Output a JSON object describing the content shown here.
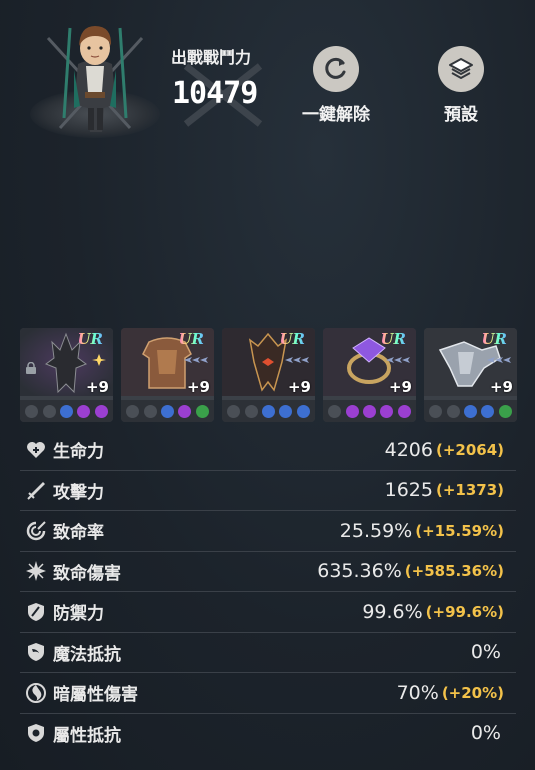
{
  "header": {
    "power_label": "出戰戰鬥力",
    "power_value": "10479",
    "reset_label": "一鍵解除",
    "preset_label": "預設"
  },
  "gear": [
    {
      "rarity": "UR",
      "enhance": "+9",
      "locked": true
    },
    {
      "rarity": "UR",
      "enhance": "+9",
      "locked": false
    },
    {
      "rarity": "UR",
      "enhance": "+9",
      "locked": false
    },
    {
      "rarity": "UR",
      "enhance": "+9",
      "locked": false
    },
    {
      "rarity": "UR",
      "enhance": "+9",
      "locked": false
    }
  ],
  "stats": [
    {
      "name": "生命力",
      "value": "4206",
      "bonus": "(+2064)",
      "icon": "heart-plus-icon"
    },
    {
      "name": "攻擊力",
      "value": "1625",
      "bonus": "(+1373)",
      "icon": "sword-icon"
    },
    {
      "name": "致命率",
      "value": "25.59%",
      "bonus": "(+15.59%)",
      "icon": "crit-rate-icon"
    },
    {
      "name": "致命傷害",
      "value": "635.36%",
      "bonus": "(+585.36%)",
      "icon": "crit-damage-icon"
    },
    {
      "name": "防禦力",
      "value": "99.6%",
      "bonus": "(+99.6%)",
      "icon": "shield-sword-icon"
    },
    {
      "name": "魔法抵抗",
      "value": "0%",
      "bonus": "",
      "icon": "magic-resist-icon"
    },
    {
      "name": "暗屬性傷害",
      "value": "70%",
      "bonus": "(+20%)",
      "icon": "dark-element-icon"
    },
    {
      "name": "屬性抵抗",
      "value": "0%",
      "bonus": "",
      "icon": "element-resist-icon"
    }
  ],
  "colors": {
    "bonus": "#f3c24a",
    "background": "#1c232b"
  }
}
